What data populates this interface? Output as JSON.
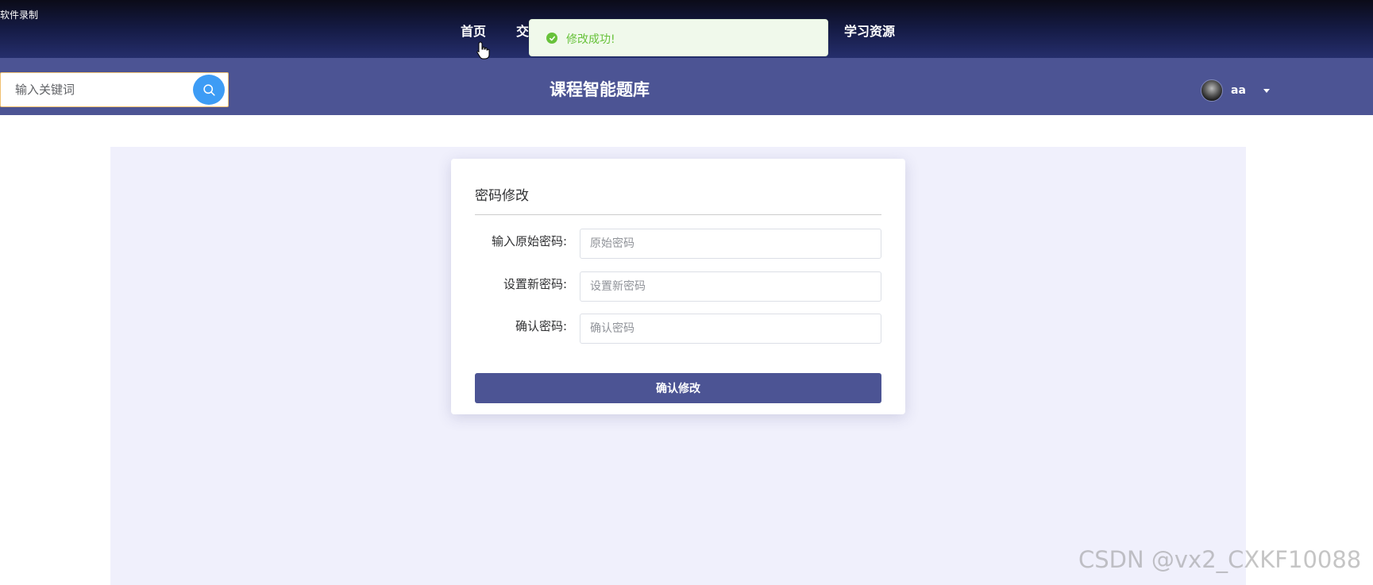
{
  "recorder": {
    "label": "软件录制"
  },
  "nav": {
    "items": [
      {
        "label": "首页"
      },
      {
        "label": "交"
      },
      {
        "label": "学习资源"
      }
    ]
  },
  "toast": {
    "message": "修改成功!",
    "icon": "success-check-icon",
    "color": "#67c23a"
  },
  "header": {
    "search": {
      "placeholder": "输入关键词",
      "icon": "search-icon"
    },
    "title": "课程智能题库",
    "user": {
      "name": "aa"
    }
  },
  "form": {
    "title": "密码修改",
    "fields": [
      {
        "label": "输入原始密码:",
        "placeholder": "原始密码",
        "value": ""
      },
      {
        "label": "设置新密码:",
        "placeholder": "设置新密码",
        "value": ""
      },
      {
        "label": "确认密码:",
        "placeholder": "确认密码",
        "value": ""
      }
    ],
    "submit_label": "确认修改"
  },
  "watermark": {
    "text": "CSDN @vx2_CXKF10088"
  },
  "colors": {
    "header": "#4c5494",
    "accent": "#3d9cf5",
    "content_bg": "#f0f0fc",
    "success": "#67c23a"
  }
}
